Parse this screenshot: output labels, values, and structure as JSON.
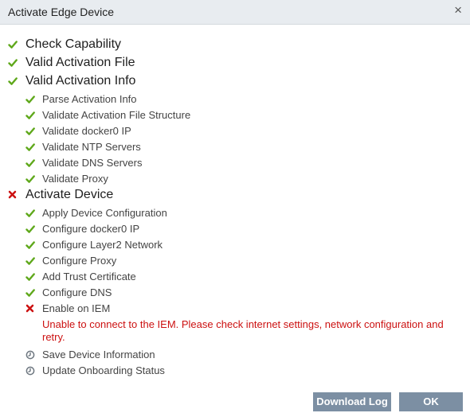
{
  "dialog": {
    "title": "Activate Edge Device",
    "close_glyph": "×"
  },
  "colors": {
    "ok": "#5fa81b",
    "error": "#cc1111",
    "pending": "#6e7780",
    "button": "#7c8fa3"
  },
  "steps": [
    {
      "label": "Check Capability",
      "status": "ok",
      "level": "main"
    },
    {
      "label": "Valid Activation File",
      "status": "ok",
      "level": "main"
    },
    {
      "label": "Valid Activation Info",
      "status": "ok",
      "level": "main"
    },
    {
      "label": "Parse Activation Info",
      "status": "ok",
      "level": "sub"
    },
    {
      "label": "Validate Activation File Structure",
      "status": "ok",
      "level": "sub"
    },
    {
      "label": "Validate docker0 IP",
      "status": "ok",
      "level": "sub"
    },
    {
      "label": "Validate NTP Servers",
      "status": "ok",
      "level": "sub"
    },
    {
      "label": "Validate DNS Servers",
      "status": "ok",
      "level": "sub"
    },
    {
      "label": "Validate Proxy",
      "status": "ok",
      "level": "sub"
    },
    {
      "label": "Activate Device",
      "status": "error",
      "level": "main"
    },
    {
      "label": "Apply Device Configuration",
      "status": "ok",
      "level": "sub"
    },
    {
      "label": "Configure docker0 IP",
      "status": "ok",
      "level": "sub"
    },
    {
      "label": "Configure Layer2 Network",
      "status": "ok",
      "level": "sub"
    },
    {
      "label": "Configure Proxy",
      "status": "ok",
      "level": "sub"
    },
    {
      "label": "Add Trust Certificate",
      "status": "ok",
      "level": "sub"
    },
    {
      "label": "Configure DNS",
      "status": "ok",
      "level": "sub"
    },
    {
      "label": "Enable on IEM",
      "status": "error",
      "level": "sub",
      "error": "Unable to connect to the IEM. Please check internet settings, network configuration and retry."
    },
    {
      "label": "Save Device Information",
      "status": "pending",
      "level": "sub"
    },
    {
      "label": "Update Onboarding Status",
      "status": "pending",
      "level": "sub"
    }
  ],
  "buttons": {
    "download_log": "Download Log",
    "ok": "OK"
  }
}
